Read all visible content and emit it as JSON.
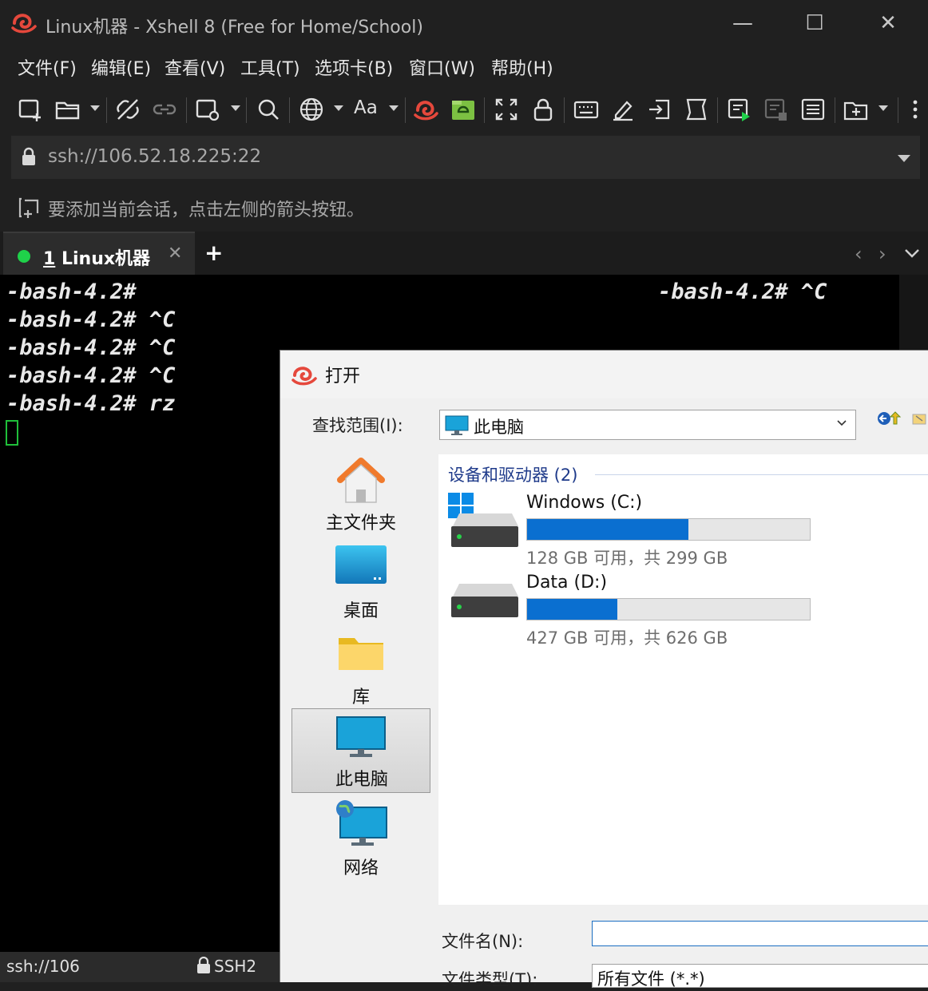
{
  "window": {
    "title": "Linux机器 - Xshell 8 (Free for Home/School)",
    "minimize": "—",
    "maximize": "☐",
    "close": "✕"
  },
  "menu": {
    "items": [
      "文件(F)",
      "编辑(E)",
      "查看(V)",
      "工具(T)",
      "选项卡(B)",
      "窗口(W)",
      "帮助(H)"
    ]
  },
  "toolbar": {
    "icons": [
      "new-session-icon",
      "open-folder-icon",
      "disconnect-icon",
      "link-icon",
      "session-settings-icon",
      "search-icon",
      "globe-icon",
      "font-icon",
      "xshell-logo-icon",
      "xftp-icon",
      "fullscreen-icon",
      "lock-icon",
      "keyboard-icon",
      "highlight-icon",
      "transfer-icon",
      "script-icon",
      "compose-icon",
      "compose-disabled-icon",
      "notes-icon",
      "add-tab-icon",
      "more-icon"
    ],
    "font_label": "Aa"
  },
  "address": {
    "value": "ssh://106.52.18.225:22"
  },
  "hint": {
    "text": "要添加当前会话，点击左侧的箭头按钮。"
  },
  "tabs": [
    {
      "index": "1",
      "label": " Linux机器",
      "status_color": "#1fd14a",
      "close": "✕"
    }
  ],
  "tab_plus": "+",
  "tab_nav": {
    "prev": "‹",
    "next": "›",
    "menu": "⌄"
  },
  "terminal": {
    "lines": [
      "-bash-4.2#",
      "-bash-4.2# ^C",
      "-bash-4.2# ^C",
      "-bash-4.2# ^C",
      "-bash-4.2# rz"
    ],
    "right_line": "-bash-4.2# ^C",
    "cursor_color": "#1fbf3a"
  },
  "status": {
    "address": "ssh://106",
    "protocol": "SSH2"
  },
  "dialog": {
    "title": "打开",
    "look_in_label": "查找范围(I):",
    "look_in_value": "此电脑",
    "places": [
      {
        "label": "主文件夹",
        "icon": "home-icon"
      },
      {
        "label": "桌面",
        "icon": "desktop-icon"
      },
      {
        "label": "库",
        "icon": "folder-icon"
      },
      {
        "label": "此电脑",
        "icon": "computer-icon",
        "selected": true
      },
      {
        "label": "网络",
        "icon": "network-icon"
      }
    ],
    "group_label": "设备和驱动器 (2)",
    "drives": [
      {
        "name": "Windows (C:)",
        "free_text": "128 GB 可用，共 299 GB",
        "used_fraction": 0.572
      },
      {
        "name": "Data (D:)",
        "free_text": "427 GB 可用，共 626 GB",
        "used_fraction": 0.318
      }
    ],
    "filename_label": "文件名(N):",
    "filename_value": "",
    "filetype_label": "文件类型(T):",
    "filetype_value": "所有文件 (*.*)"
  }
}
